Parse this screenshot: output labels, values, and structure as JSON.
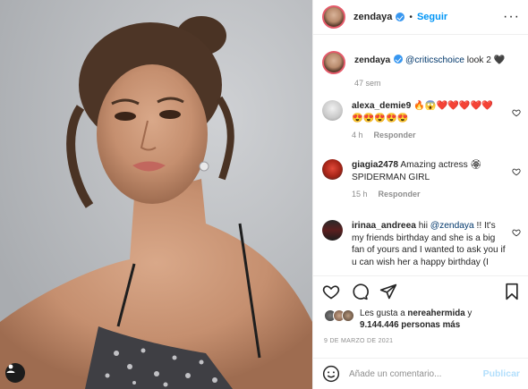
{
  "post": {
    "author": "zendaya",
    "verified": true,
    "follow_label": "Seguir",
    "more_icon": "more-options-icon",
    "photo_tag_icon": "user-tag-icon"
  },
  "caption": {
    "user": "zendaya",
    "mention": "@criticschoice",
    "text": " look 2",
    "emoji": "🖤",
    "time": "47 sem"
  },
  "comments": [
    {
      "user": "alexa_demie9",
      "text": "🔥😱❤️❤️❤️❤️❤️ 😍😍😍😍😍",
      "time": "4 h",
      "reply_label": "Responder"
    },
    {
      "user": "giagia2478",
      "text": "Amazing actress 🏵 SPIDERMAN GIRL",
      "time": "15 h",
      "reply_label": "Responder"
    },
    {
      "user": "irinaa_andreea",
      "text_before": "hii ",
      "mention": "@zendaya",
      "text_after": " !! It's my friends birthday and she is a big fan of yours and I wanted to ask you if u can wish her a happy birthday (I",
      "time": "",
      "reply_label": ""
    }
  ],
  "actions": {
    "like_icon": "heart-icon",
    "comment_icon": "comment-icon",
    "share_icon": "share-icon",
    "save_icon": "bookmark-icon"
  },
  "likes": {
    "prefix": "Les gusta a ",
    "user": "nereahermida",
    "middle": " y",
    "count": "9.144.446 personas más"
  },
  "date": "9 DE MARZO DE 2021",
  "comment_box": {
    "placeholder": "Añade un comentario...",
    "publish_label": "Publicar",
    "emoji_icon": "emoji-smiley-icon"
  },
  "colors": {
    "accent": "#0095f6",
    "verified": "#3897f0",
    "muted": "#8e8e8e",
    "border": "#efefef",
    "publish_disabled": "#b2dffc"
  }
}
